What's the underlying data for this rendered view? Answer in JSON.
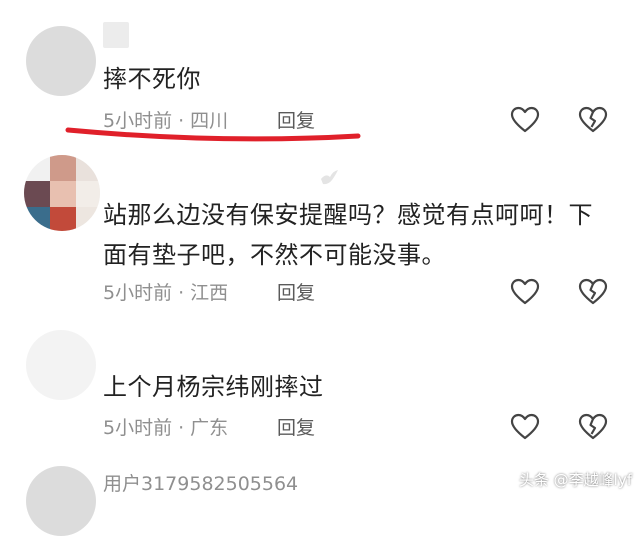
{
  "comments": [
    {
      "text": "摔不死你",
      "time": "5小时前",
      "location": "四川",
      "separator": "·",
      "reply_label": "回复",
      "like_icon": "heart-outline-icon",
      "dislike_icon": "broken-heart-icon"
    },
    {
      "text_line1": "站那么边没有保安提醒吗？感觉有点呵呵！下",
      "text_line2": "面有垫子吧，不然不可能没事。",
      "time": "5小时前",
      "location": "江西",
      "separator": "·",
      "reply_label": "回复",
      "like_icon": "heart-outline-icon",
      "dislike_icon": "broken-heart-icon"
    },
    {
      "text": "上个月杨宗纬刚摔过",
      "time": "5小时前",
      "location": "广东",
      "separator": "·",
      "reply_label": "回复",
      "like_icon": "heart-outline-icon",
      "dislike_icon": "broken-heart-icon"
    }
  ],
  "next_comment": {
    "username": "用户3179582505564"
  },
  "watermark": "头条 @李越峰lyf",
  "colors": {
    "annotation_underline": "#e0202a",
    "meta_text": "#8f8f8f",
    "icon_stroke": "#444444"
  }
}
